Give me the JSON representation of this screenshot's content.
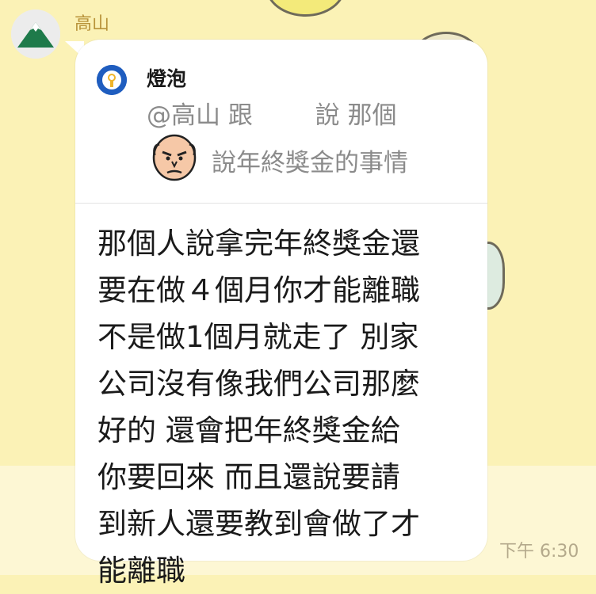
{
  "sender": {
    "name": "高山"
  },
  "reply_preview": {
    "name": "燈泡",
    "line1": "@高山 跟        說 那個",
    "line2": "說年終獎金的事情"
  },
  "message": {
    "lines": [
      "那個人說拿完年終獎金還",
      "要在做４個月你才能離職",
      "不是做1個月就走了 別家",
      "公司沒有像我們公司那麼",
      "好的 還會把年終獎金給",
      "你要回來 而且還說要請",
      "到新人還要教到會做了才",
      "能離職"
    ]
  },
  "timestamp": "下午 6:30",
  "icons": {
    "avatar": "mountain-avatar-icon",
    "quote": "lightbulb-icon",
    "face": "angry-bald-face-sticker"
  },
  "colors": {
    "background": "#fbf2b6",
    "bubble": "#ffffff",
    "sender_name": "#b8933a",
    "quote_text": "#8b8b8b",
    "timestamp": "#b4a98b",
    "quote_icon": "#1f5dbf"
  }
}
